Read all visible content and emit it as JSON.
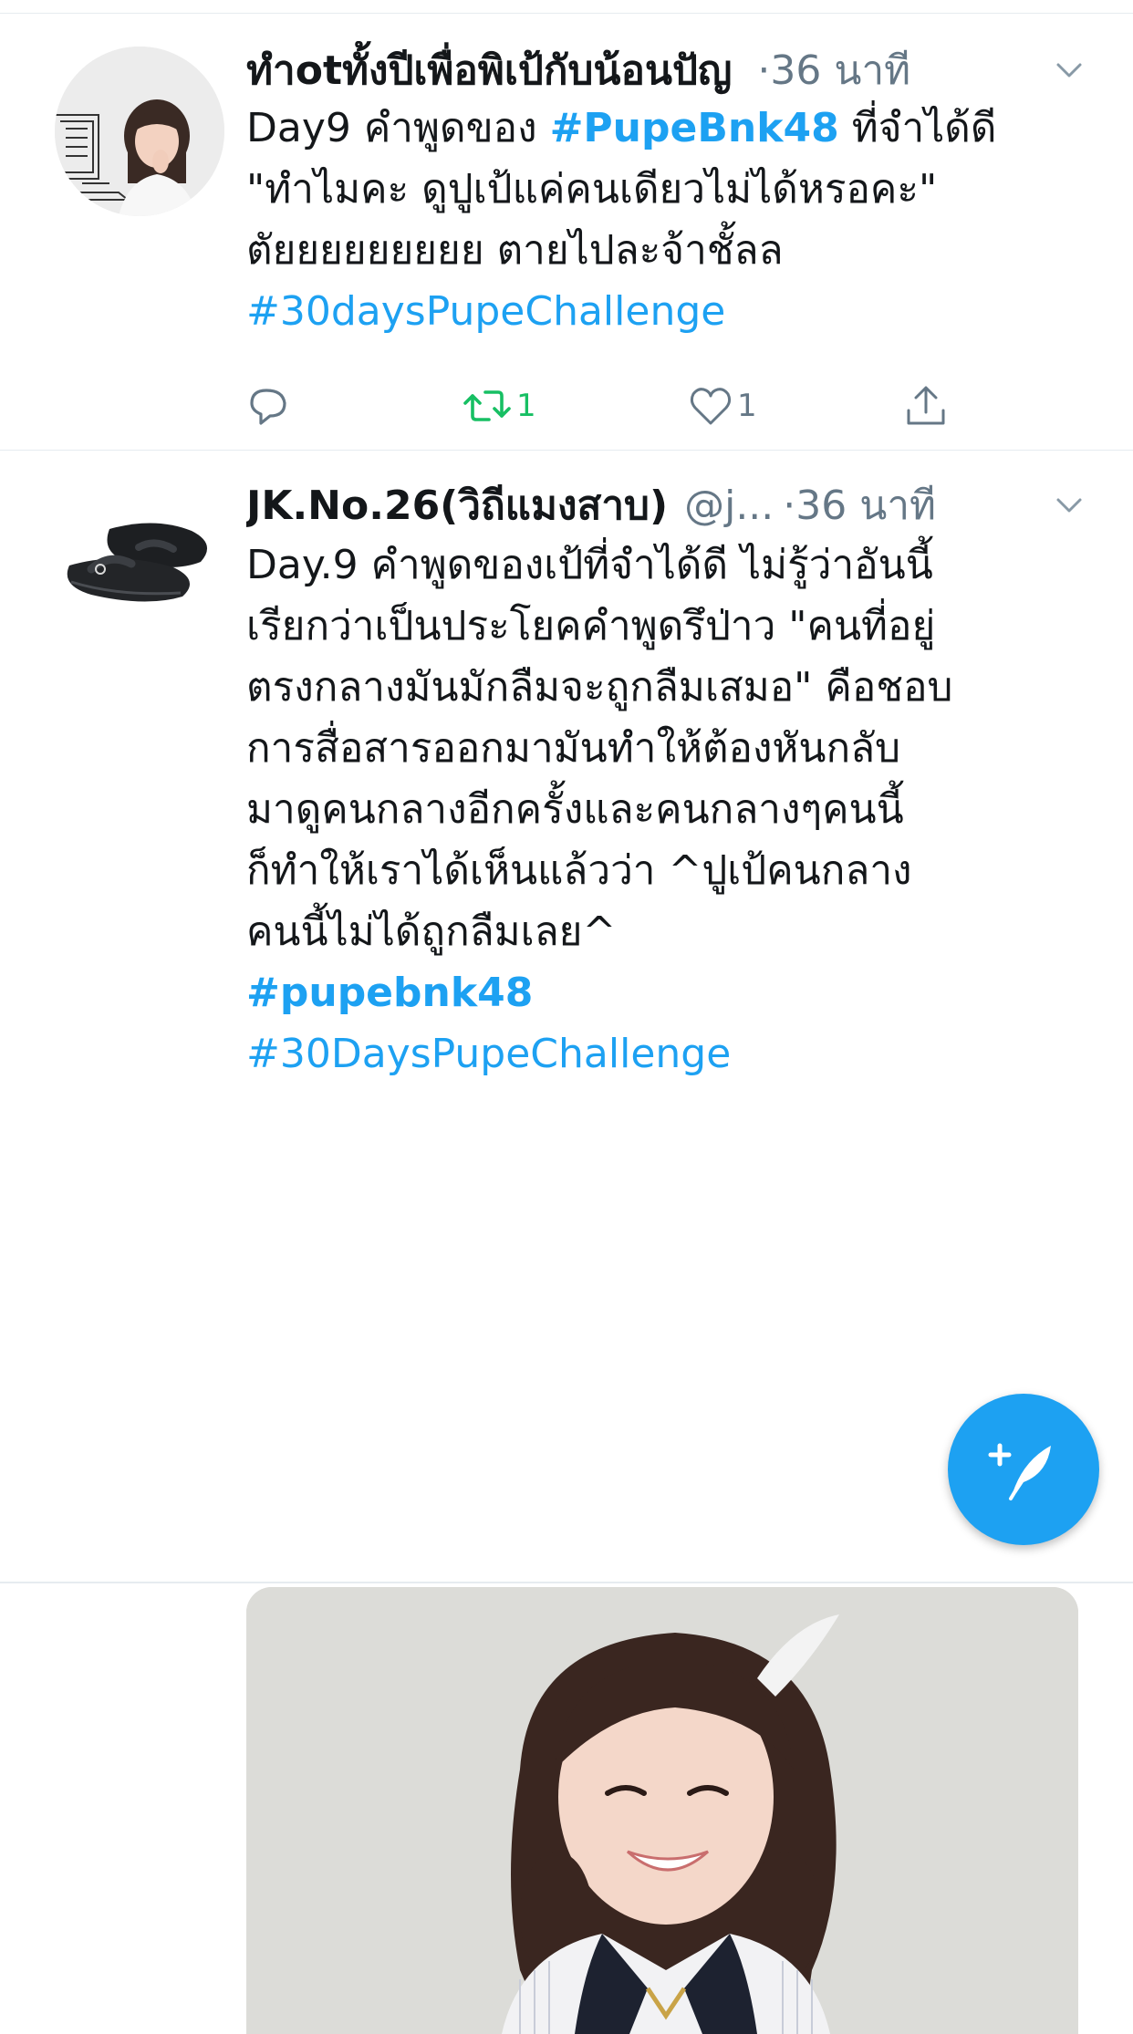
{
  "tweets": [
    {
      "display_name": "ทำotทั้งปีเพื่อพิเป้กับน้อนปัญ",
      "handle": "",
      "time": "·36 นาที",
      "lines": [
        [
          {
            "t": "Day9 คำพูดของ "
          },
          {
            "t": "#PupeBnk48",
            "tag": true,
            "bold": true
          },
          {
            "t": " ที่จำได้ดี"
          }
        ],
        [
          {
            "t": "\"ทำไมคะ ดูปูเป้แค่คนเดียวไม่ได้หรอคะ\""
          }
        ],
        [
          {
            "t": "ตัยยยยยยยยย ตายไปละจ้าชั้ลล"
          }
        ],
        [
          {
            "t": "#30daysPupeChallenge",
            "tag": true
          }
        ]
      ],
      "actions": {
        "reply_count": "",
        "retweet_count": "1",
        "like_count": "1"
      }
    },
    {
      "display_name": "JK.No.26(วิถีแมงสาบ)",
      "handle": "@j...",
      "time": "·36 นาที",
      "lines": [
        [
          {
            "t": "Day.9 คำพูดของเป้ที่จำได้ดี ไม่รู้ว่าอันนี้"
          }
        ],
        [
          {
            "t": "เรียกว่าเป็นประโยคคำพูดรึป่าว \"คนที่อยู่"
          }
        ],
        [
          {
            "t": "ตรงกลางมันมักลืมจะถูกลืมเสมอ\" คือชอบ"
          }
        ],
        [
          {
            "t": "การสื่อสารออกมามันทำให้ต้องหันกลับ"
          }
        ],
        [
          {
            "t": "มาดูคนกลางอีกครั้งและคนกลางๆคนนี้"
          }
        ],
        [
          {
            "t": "ก็ทำให้เราได้เห็นแล้วว่า ^ปูเป้คนกลาง"
          }
        ],
        [
          {
            "t": "คนนี้ไม่ได้ถูกลืมเลย^"
          }
        ],
        [
          {
            "t": "#pupebnk48",
            "tag": true,
            "bold": true
          }
        ],
        [
          {
            "t": "#30DaysPupeChallenge",
            "tag": true
          }
        ]
      ]
    }
  ],
  "colors": {
    "accent": "#1da1f2",
    "retweet_green": "#17bf63",
    "muted": "#657786",
    "text": "#14171a",
    "divider": "#e6ecf0"
  },
  "icons": {
    "reply": "reply-icon",
    "retweet": "retweet-icon",
    "like": "heart-icon",
    "share": "share-icon",
    "compose": "compose-tweet-icon",
    "more": "chevron-down-icon"
  }
}
